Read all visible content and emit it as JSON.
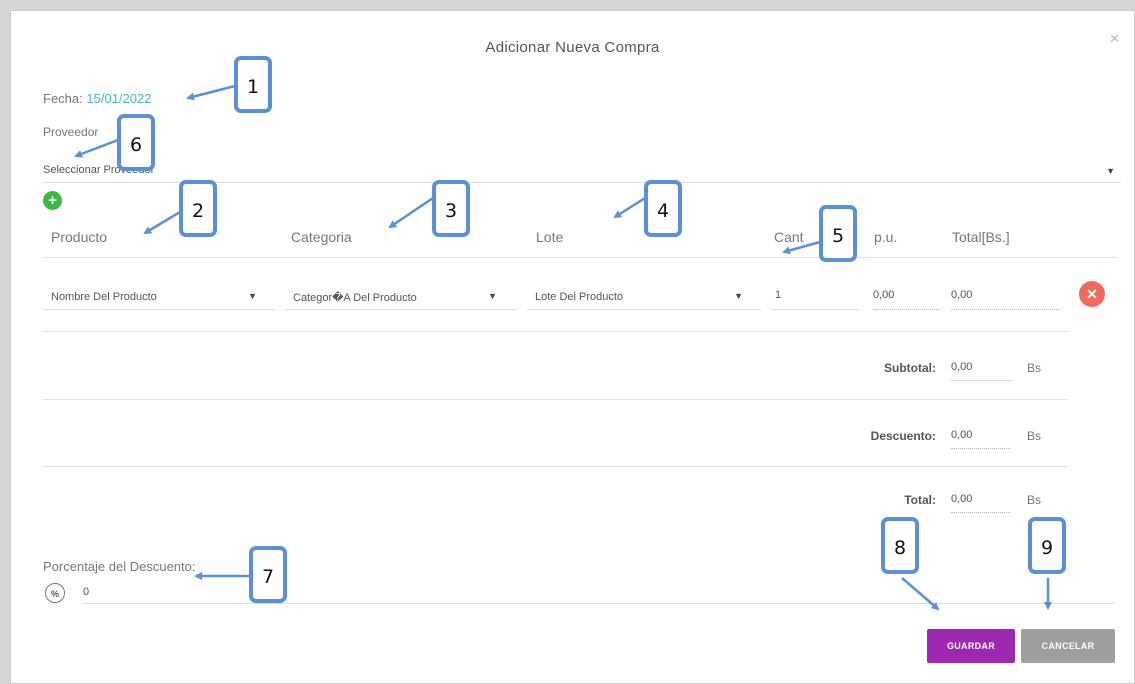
{
  "modal": {
    "title": "Adicionar Nueva Compra",
    "close_icon": "close-icon",
    "fecha_label": "Fecha:",
    "fecha_value": "15/01/2022",
    "proveedor_label": "Proveedor",
    "proveedor_placeholder": "Seleccionar Proveedor",
    "add_icon": "plus-icon"
  },
  "table": {
    "headers": [
      "Producto",
      "Categoria",
      "Lote",
      "Cant",
      "p.u.",
      "Total[Bs.]"
    ],
    "row": {
      "producto": "Nombre Del Producto",
      "categoria": "Categor�A Del Producto",
      "lote": "Lote Del Producto",
      "cant": "1",
      "pu": "0,00",
      "total": "0,00",
      "delete_icon": "close-circle-icon"
    }
  },
  "totals": {
    "subtotal_label": "Subtotal:",
    "subtotal_value": "0,00",
    "descuento_label": "Descuento:",
    "descuento_value": "0,00",
    "total_label": "Total:",
    "total_value": "0,00",
    "currency": "Bs"
  },
  "discount": {
    "label": "Porcentaje del Descuento:",
    "icon": "percent-icon",
    "icon_text": "%",
    "value": "0"
  },
  "buttons": {
    "guardar": "GUARDAR",
    "cancelar": "CANCELAR"
  },
  "callouts": [
    "1",
    "2",
    "3",
    "4",
    "5",
    "6",
    "7",
    "8",
    "9"
  ],
  "colors": {
    "accent_date": "#45b7c9",
    "add_button": "#3db843",
    "delete_button": "#ef6a5f",
    "guardar_button": "#9c27b0",
    "cancelar_button": "#9e9e9e",
    "callout_border": "#5b8fd6"
  }
}
